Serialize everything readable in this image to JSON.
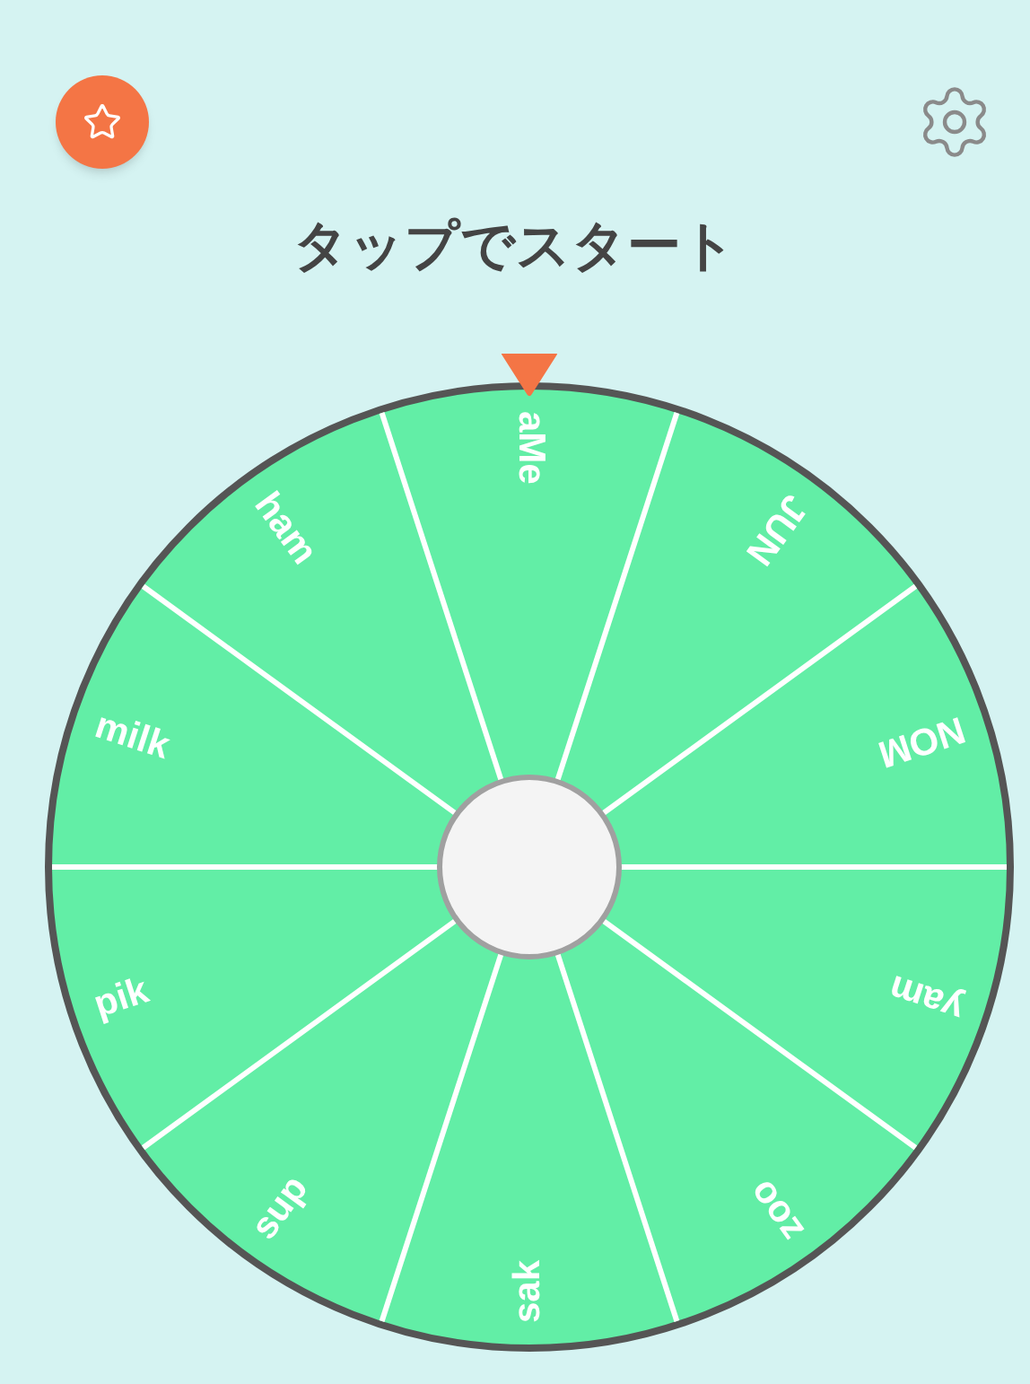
{
  "title": "タップでスタート",
  "segments": [
    {
      "label": "aMe"
    },
    {
      "label": "JUN"
    },
    {
      "label": "NOM"
    },
    {
      "label": "yam"
    },
    {
      "label": "zoo"
    },
    {
      "label": "sak"
    },
    {
      "label": "sup"
    },
    {
      "label": "pik"
    },
    {
      "label": "milk"
    },
    {
      "label": "ham"
    }
  ]
}
